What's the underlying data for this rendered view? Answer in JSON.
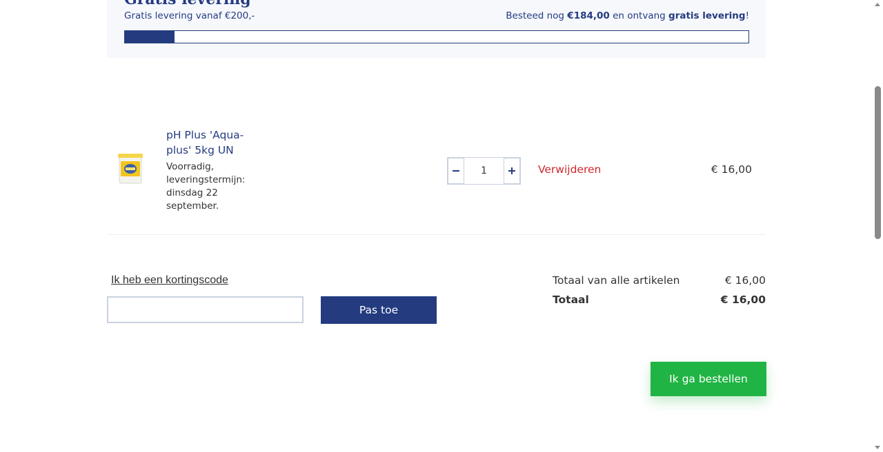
{
  "delivery": {
    "title": "Gratis levering",
    "subtitle": "Gratis levering vanaf €200,-",
    "message_prefix": "Besteed nog ",
    "remaining_amount": "€184,00",
    "message_middle": " en ontvang ",
    "message_bold": "gratis levering",
    "message_suffix": "!",
    "progress": 0.08
  },
  "cart": {
    "items": [
      {
        "name": "pH Plus 'Aqua-plus' 5kg UN",
        "stock": "Voorradig, leveringstermijn: dinsdag 22 september.",
        "quantity": "1",
        "remove_label": "Verwijderen",
        "price": "€ 16,00",
        "image_icon": "product-bucket-icon"
      }
    ]
  },
  "discount": {
    "label": "Ik heb een kortingscode",
    "placeholder": "",
    "apply_label": "Pas toe"
  },
  "totals": {
    "subtotal_label": "Totaal van alle artikelen",
    "subtotal_value": "€ 16,00",
    "total_label": "Totaal",
    "total_value": "€ 16,00"
  },
  "order_button": "Ik ga bestellen",
  "colors": {
    "brand": "#243b80",
    "danger": "#d0262e",
    "success": "#20b444"
  }
}
